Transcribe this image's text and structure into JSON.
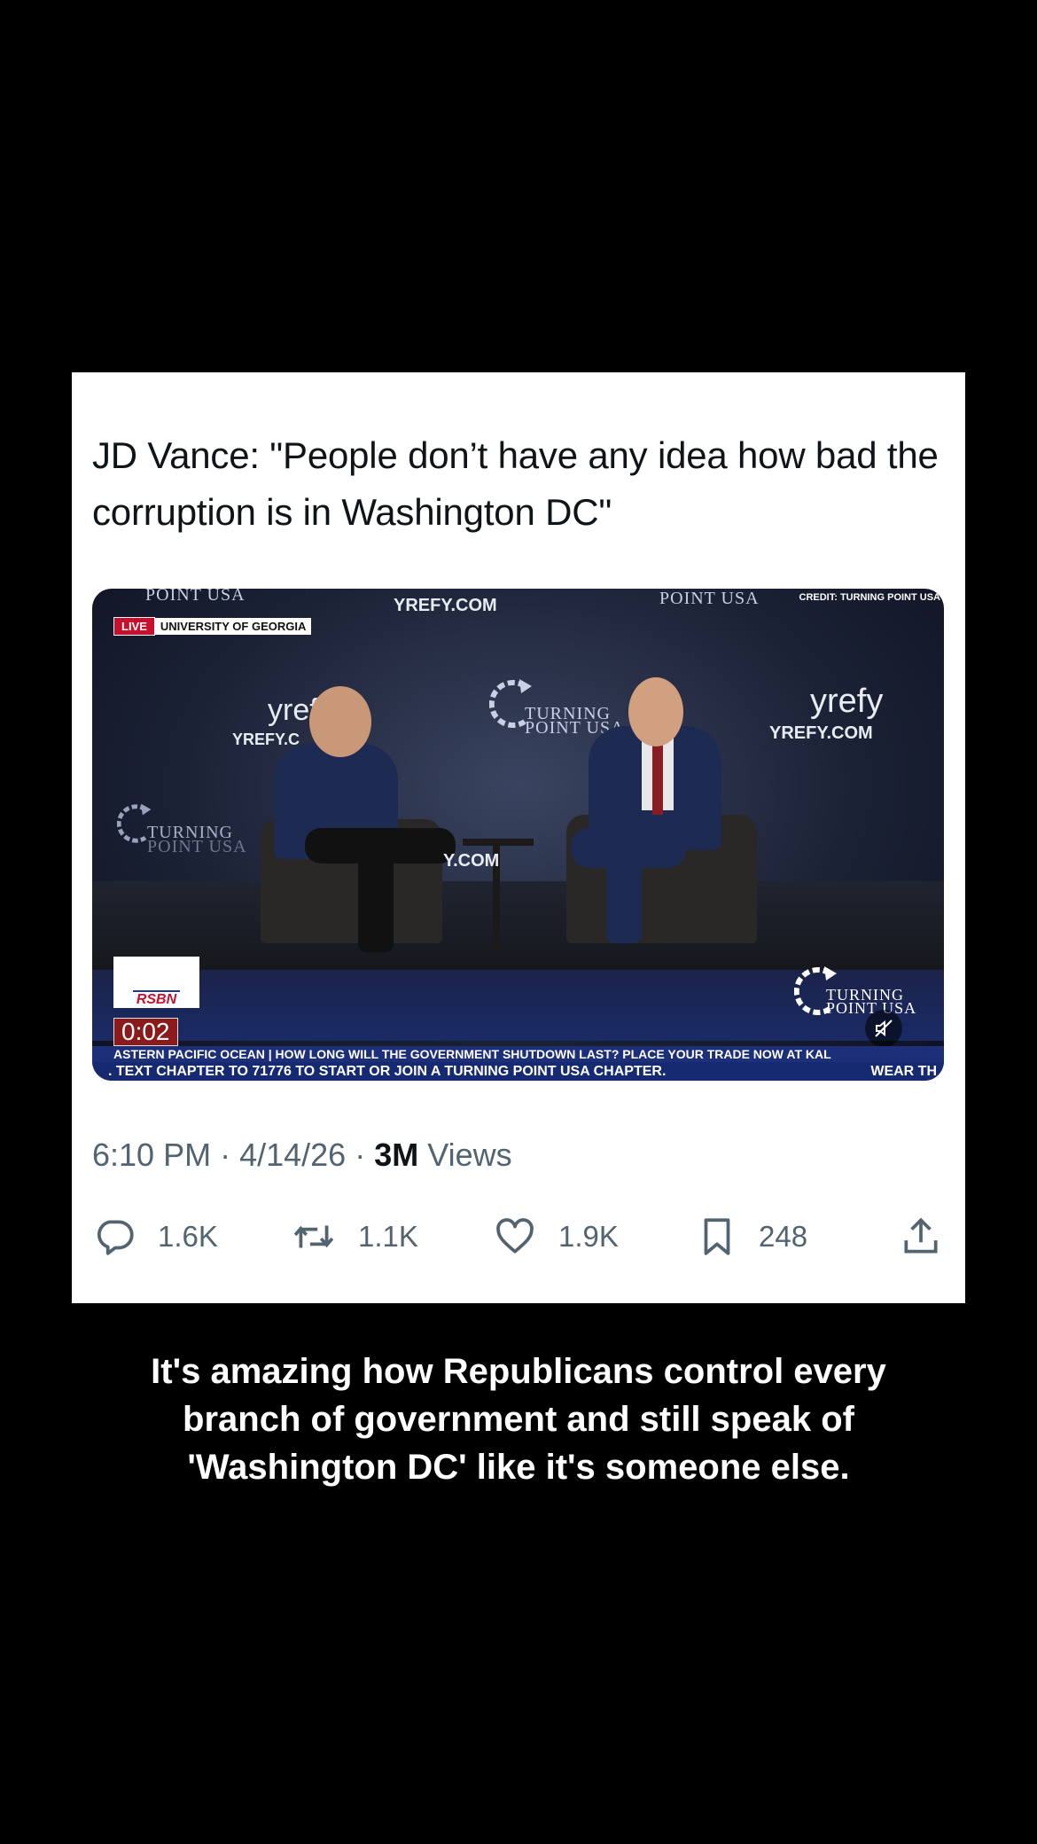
{
  "tweet": {
    "text": "JD Vance: \"People don’t have any idea how bad the corruption is in Washington DC\""
  },
  "video": {
    "live_label": "LIVE",
    "location": "UNIVERSITY OF GEORGIA",
    "credit": "CREDIT: TURNING POINT USA",
    "banner_top_left": "POINT USA",
    "banner_top_center": "YREFY.COM",
    "banner_top_right": "POINT USA",
    "banner_left": "YREFY.C",
    "banner_right": "YREFY.COM",
    "banner_center_line1": "TURNING",
    "banner_center_line2": "POINT USA",
    "banner_side_left_1": "TURNING",
    "banner_side_left_2": "POINT USA",
    "yrefy_logo": "yrefy",
    "rsbn_logo": "RSBN",
    "timer": "0:02",
    "ticker_top": "ASTERN PACIFIC OCEAN | HOW LONG WILL THE GOVERNMENT SHUTDOWN LAST? PLACE YOUR TRADE NOW AT KAL",
    "ticker_bottom": ". TEXT CHAPTER TO 71776 TO START OR JOIN A TURNING POINT USA CHAPTER.",
    "ticker_bottom_right": "WEAR TH",
    "watermark_line1": "TURNING",
    "watermark_line2": "POINT USA"
  },
  "meta": {
    "time": "6:10 PM",
    "date": "4/14/26",
    "views_count": "3M",
    "views_label": "Views"
  },
  "actions": {
    "replies": "1.6K",
    "reposts": "1.1K",
    "likes": "1.9K",
    "bookmarks": "248"
  },
  "caption": {
    "line1": "It's amazing how Republicans control every",
    "line2": "branch of government and still speak of",
    "line3": "'Washington DC' like it's someone else."
  },
  "colors": {
    "card_bg": "#ffffff",
    "page_bg": "#000000",
    "text_primary": "#0f1419",
    "text_secondary": "#536471",
    "live_red": "#c8102e"
  }
}
